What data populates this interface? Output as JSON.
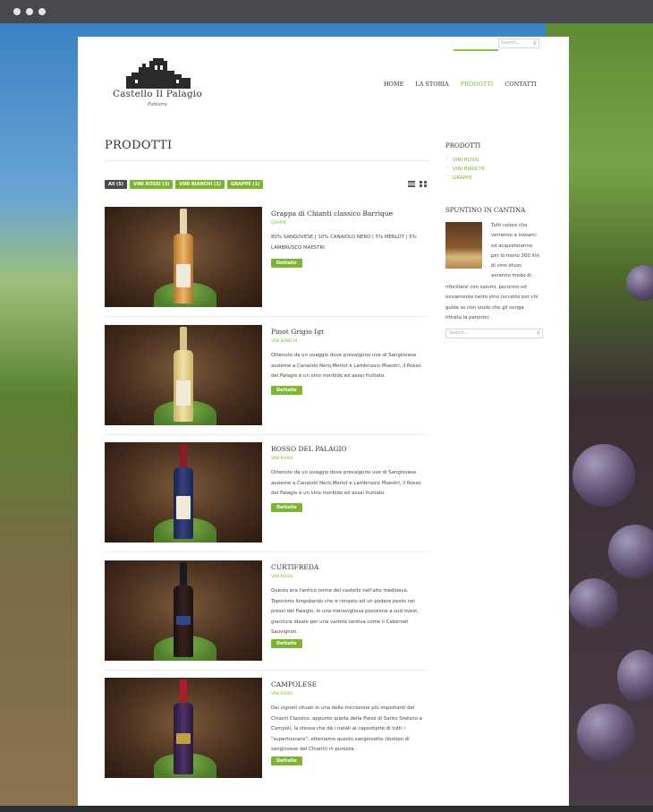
{
  "site": {
    "logo_name": "Castello Il Palagio",
    "logo_sub": "Fattoria"
  },
  "search": {
    "placeholder": "Search..."
  },
  "nav": {
    "items": [
      {
        "label": "HOME",
        "active": false
      },
      {
        "label": "LA STORIA",
        "active": false
      },
      {
        "label": "PRODOTTI",
        "active": true
      },
      {
        "label": "CONTATTI",
        "active": false
      }
    ]
  },
  "main": {
    "title": "PRODOTTI",
    "filters": [
      {
        "label": "All (5)",
        "active": true
      },
      {
        "label": "VINI ROSSI (3)",
        "active": false
      },
      {
        "label": "VINI BIANCHI (1)",
        "active": false
      },
      {
        "label": "GRAPPE (1)",
        "active": false
      }
    ],
    "detail_label": "Dettalio",
    "products": [
      {
        "name": "Grappa di Chianti classico Barrique",
        "category": "GRAPPE",
        "description": "80% SANGOVESE | 10% CANAIOLO NERO | 5% MERLOT | 5% LAMBRUSCO MAESTRI"
      },
      {
        "name": "Pinot Grigio Igt",
        "category": "VINI BIANCHI",
        "description": "Ottenuto da un uvaggio dove prevalgono uve di Sangiovese assieme a Canaiolo Nero,Merlot e Lambrusco Maestri, il Rosso del Palagio è un vino morbido ed assai fruttato."
      },
      {
        "name": "ROSSO DEL PALAGIO",
        "category": "VINI ROSSI",
        "description": "Ottenuto da un uvaggio dove prevalgono uve di Sangiovese assieme a Canaiolo Nero,Merlot e Lambrusco Maestri, il Rosso del Palagio è un vino morbido ed assai fruttato."
      },
      {
        "name": "CURTIFREDA",
        "category": "VINI ROSSI",
        "description": "Questo era l'antico nome del castello nell'alto medioevo. Toponimo longobardo che è rimasto ad un podere posto nei pressi del Palagio, in una meravigliosa posizione a sud ovest, giacitura ideale per una varietà tardiva come il Cabernet Sauvignon."
      },
      {
        "name": "CAMPOLESE",
        "category": "VINI ROSSI",
        "description": "Dai vigneti situati in una delle microzone più importanti del Chianti Classico, appunto quella della Pieve di Santo Stefano a Campòli, la stessa che dà i natali al capostipite di tutti i \"supertuscans\", otteniamo questo sangiovetto (biotipo di sangiovese del Chianti) in purezza."
      }
    ]
  },
  "sidebar": {
    "products_heading": "PRODOTTI",
    "categories": [
      "VINI ROSSI",
      "VINI BIANCHI",
      "GRAPPE"
    ],
    "snack_heading": "SPUNTINO IN CANTINA",
    "snack_lines_beside": [
      "Tutti coloro che",
      "verranno a trovarci",
      "ed acquisteranno",
      "per lo meno 300 litri",
      "di vino sfuso,",
      "avranno modo di"
    ],
    "snack_lines_full": [
      "rifocillarsi con salumi, pecorino ed",
      "ovviamente tanto vino (eccetto per chi",
      "guida se non vuole che gli venga",
      "ritirata la patente)."
    ]
  },
  "colors": {
    "accent": "#7cb631",
    "dark_button": "#4a4a4a"
  }
}
